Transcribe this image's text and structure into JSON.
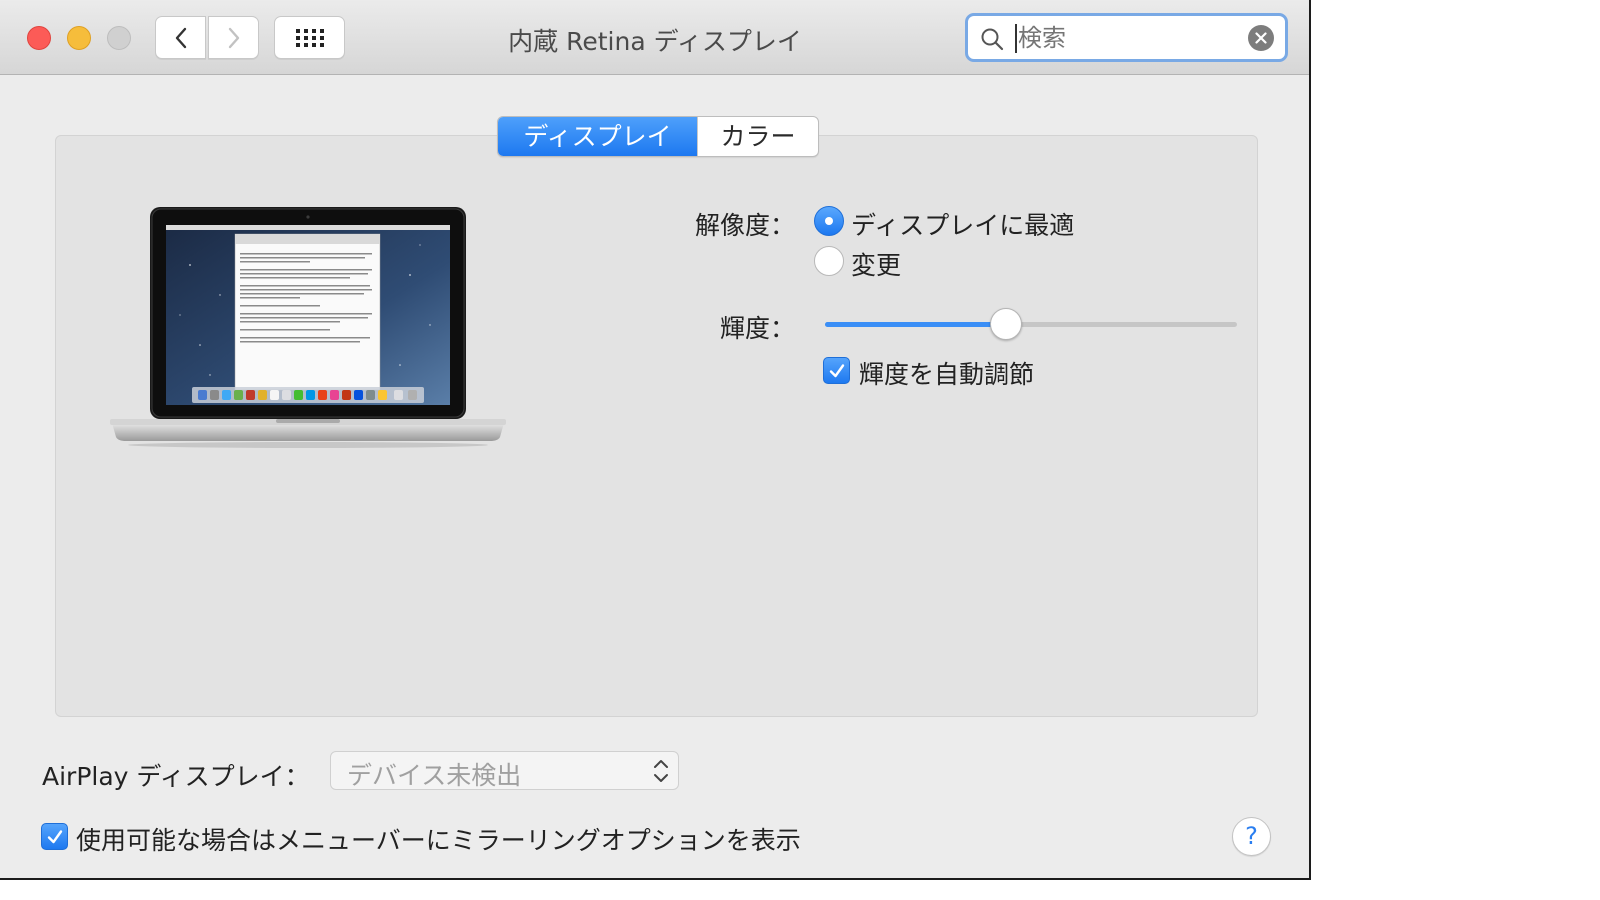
{
  "window": {
    "title": "内蔵 Retina ディスプレイ"
  },
  "search": {
    "placeholder": "検索",
    "value": ""
  },
  "tabs": [
    {
      "label": "ディスプレイ",
      "selected": true
    },
    {
      "label": "カラー",
      "selected": false
    }
  ],
  "resolution": {
    "label": "解像度：",
    "options": [
      {
        "label": "ディスプレイに最適",
        "selected": true
      },
      {
        "label": "変更",
        "selected": false
      }
    ]
  },
  "brightness": {
    "label": "輝度：",
    "level": 0.44,
    "auto_label": "輝度を自動調節",
    "auto_checked": true
  },
  "airplay": {
    "label": "AirPlay ディスプレイ：",
    "selected": "デバイス未検出"
  },
  "mirroring": {
    "label": "使用可能な場合はメニューバーにミラーリングオプションを表示",
    "checked": true
  },
  "help": {
    "label": "?"
  },
  "colors": {
    "accent": "#1d78f0",
    "close": "#fc5b57",
    "minimize": "#f6bd3b",
    "zoom_disabled": "#d0d0d0"
  },
  "icons": [
    "back-chevron-icon",
    "forward-chevron-icon",
    "grid-icon",
    "search-icon",
    "clear-icon",
    "popup-arrows-icon",
    "checkmark-icon"
  ]
}
